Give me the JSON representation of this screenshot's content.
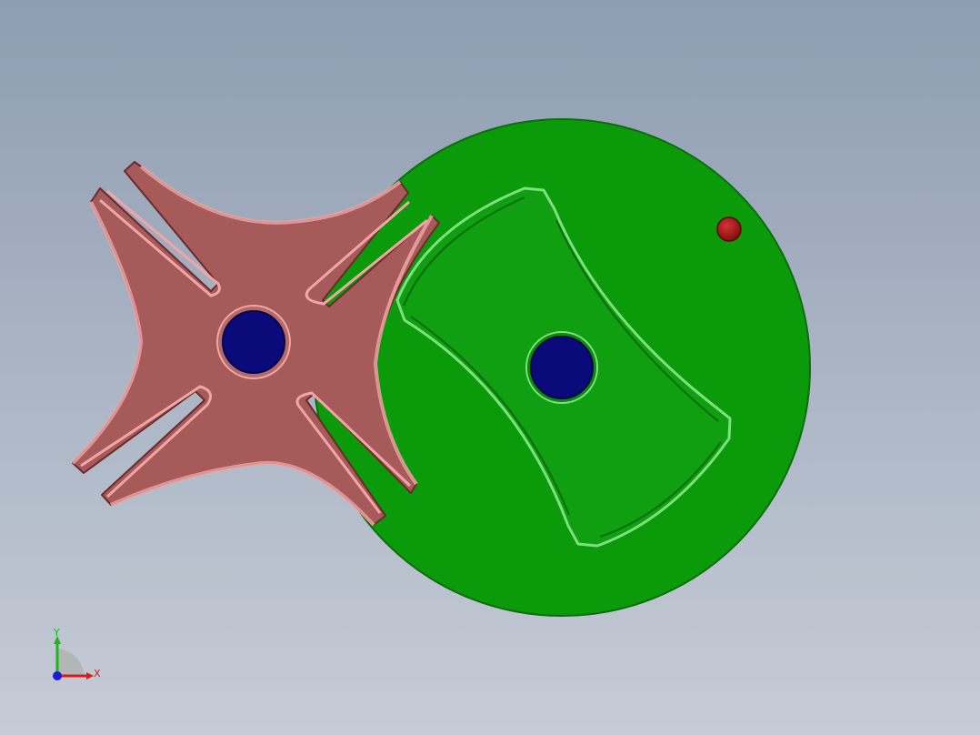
{
  "viewport": {
    "background_top": "#8e9db2",
    "background_bottom": "#c6ccd6"
  },
  "parts": {
    "drive_wheel": {
      "color": "#0a9a0a",
      "edge_color": "#0b6d0b",
      "locking_disc_color": "#13b013",
      "locking_disc_edge": "#7ee07e",
      "hub_hole_color": "#0a0a7a",
      "pin_color": "#a61111",
      "pin_edge": "#5a0606"
    },
    "geneva_wheel": {
      "color": "#a65a5a",
      "edge_color": "#6b2a2a",
      "highlight_color": "#f0a6a6",
      "hub_hole_color": "#0a0a7a",
      "slot_count": 4
    }
  },
  "triad": {
    "x_label": "X",
    "y_label": "Y",
    "x_color": "#d81b1b",
    "y_color": "#1bb81b",
    "z_color": "#1b1bd8"
  }
}
